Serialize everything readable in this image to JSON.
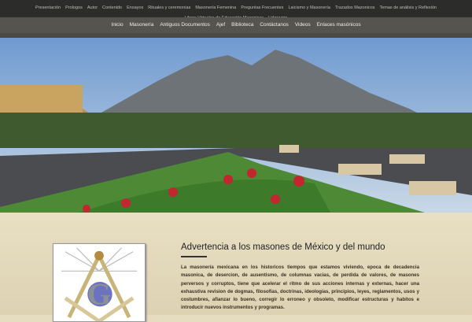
{
  "top_nav": [
    "Presentación",
    "Prologos",
    "Autor",
    "Contenido",
    "Ensayos",
    "Rituales y ceremonias",
    "Masonería Femenina",
    "Preguntas Frecuentes",
    "Laicismo y Masonería",
    "Trazados Mazonicos",
    "Temas de análisis y Reflexión",
    "Libros Virtuales de Educación Masonicas",
    "Liderazgo"
  ],
  "main_nav": [
    "Inicio",
    "Masonería",
    "Antiguos Documentos",
    "Ajef",
    "Biblioteca",
    "Contáctanos",
    "Videos",
    "Enlaces masónicos"
  ],
  "article": {
    "title": "Advertencia a los masones de México y del mundo",
    "body": "La masonería mexicana en los historicos tiempos que estamos viviendo, epoca de decadencia masonica, de desercion, de ausentismo, de columnas vacias, de perdida de valores, de masones perversos y corruptos, tiene que acelerar el ritmo de sus acciones internas y externas, hacer una exhaustiva revision de dogmas, filosofías, doctrinas, ideologías, principios, leyes, reglamentos, usos y costumbres, afianzar lo bueno, corregir lo erroneo y obsoleto, modificar estructuras y habitos e introducir nuevos instrumentos y programas."
  }
}
